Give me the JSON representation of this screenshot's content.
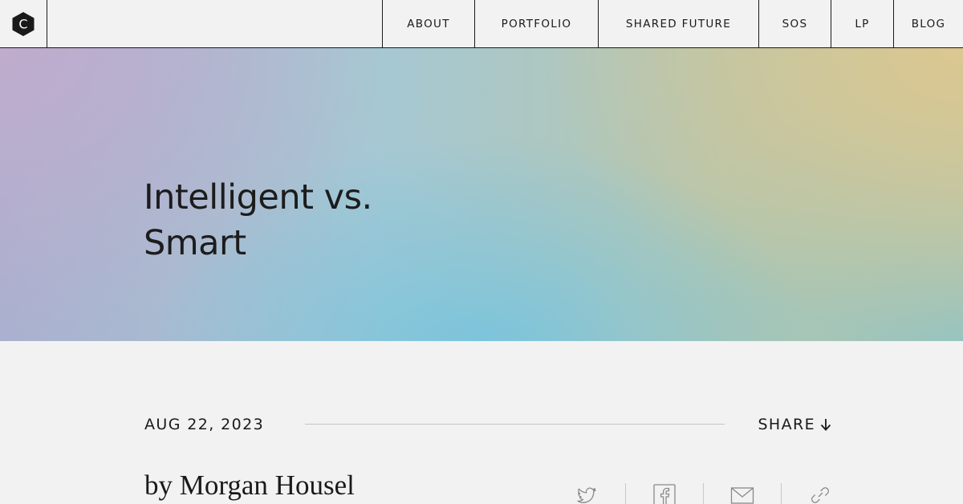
{
  "nav": {
    "logo_letter": "C",
    "items": [
      {
        "label": "ABOUT",
        "name": "about"
      },
      {
        "label": "PORTFOLIO",
        "name": "portfolio"
      },
      {
        "label": "SHARED FUTURE",
        "name": "shared-future"
      },
      {
        "label": "SOS",
        "name": "sos"
      },
      {
        "label": "LP",
        "name": "lp"
      },
      {
        "label": "BLOG",
        "name": "blog"
      }
    ]
  },
  "hero": {
    "title_line1": "Intelligent vs.",
    "title_line2": "Smart"
  },
  "post": {
    "date": "AUG 22, 2023",
    "share_label": "SHARE",
    "author": "by Morgan Housel"
  },
  "social": {
    "icons": [
      "twitter-icon",
      "facebook-icon",
      "email-icon",
      "link-icon"
    ],
    "icon_color": "#8a8a8a"
  },
  "colors": {
    "background": "#f2f2f2",
    "text": "#1a1a1a",
    "hero_cyan": "#76c4de",
    "hero_gold": "#dbc791",
    "hero_lavender": "#c0accd"
  }
}
